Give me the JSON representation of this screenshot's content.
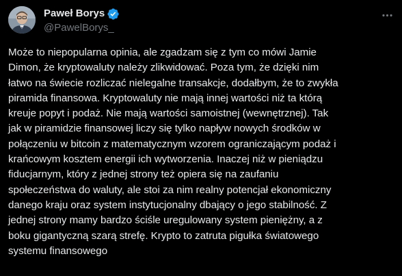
{
  "author": {
    "display_name": "Paweł Borys",
    "handle": "@PawelBorys_",
    "verified": true,
    "verified_color": "#1d9bf0"
  },
  "icons": {
    "verified": "verified-badge-icon",
    "more": "more-horizontal-icon"
  },
  "tweet": {
    "text": "Może to niepopularna opinia, ale zgadzam się z tym co mówi Jamie\nDimon, że kryptowaluty należy zlikwidować. Poza tym, że dzięki nim\nłatwo na świecie rozliczać nielegalne transakcje, dodałbym, że to zwykła\npiramida finansowa. Kryptowaluty nie mają innej wartości niż ta którą\nkreuje popyt i podaż. Nie mają wartości samoistnej (wewnętrznej). Tak\njak w piramidzie finansowej liczy się tylko napływ nowych środków w\npołączeniu w bitcoin z matematycznym wzorem ograniczającym podaż i\nkrańcowym kosztem energii ich wytworzenia. Inaczej niż w pieniądzu\nfiducjarnym, który z jednej strony też opiera się na zaufaniu\nspołeczeństwa do waluty, ale stoi za nim realny potencjał ekonomiczny\ndanego kraju oraz system instytucjonalny dbający o jego stabilność. Z\njednej strony mamy bardzo ściśle uregulowany system pieniężny, a z\nboku gigantyczną szarą strefę. Krypto to zatruta pigułka światowego\nsystemu finansowego"
  },
  "colors": {
    "background": "#000000",
    "text": "#e7e9ea",
    "secondary": "#71767b"
  }
}
